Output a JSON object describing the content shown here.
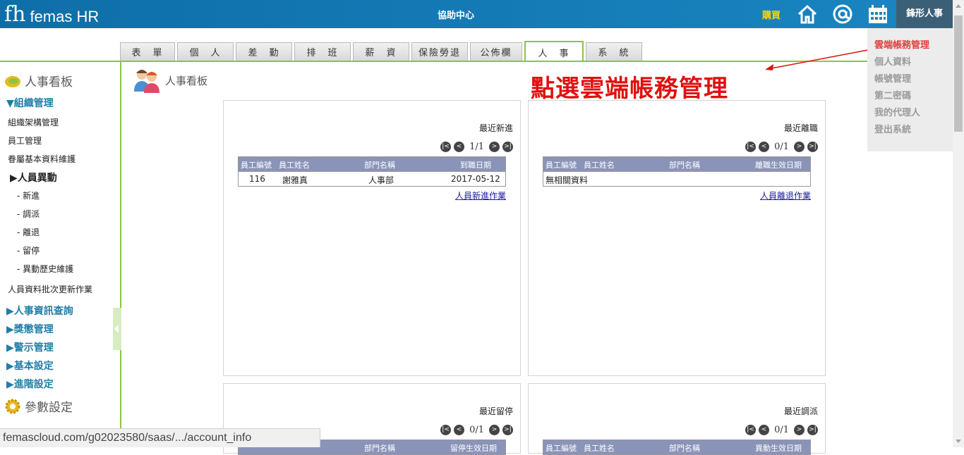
{
  "header": {
    "logo_mark": "fh",
    "logo_text": "femas HR",
    "help_center": "協助中心",
    "buy": "購買",
    "user_menu": "鋒形人事",
    "brand_color": "#1a86c2",
    "buy_color": "#ffd200"
  },
  "tabs": [
    {
      "label": "表　單",
      "active": false
    },
    {
      "label": "個　人",
      "active": false
    },
    {
      "label": "差　勤",
      "active": false
    },
    {
      "label": "排　班",
      "active": false
    },
    {
      "label": "薪　資",
      "active": false
    },
    {
      "label": "保險勞退",
      "active": false
    },
    {
      "label": "公佈欄",
      "active": false
    },
    {
      "label": "人　事",
      "active": true
    },
    {
      "label": "系　統",
      "active": false
    }
  ],
  "sidebar": {
    "board_title": "人事看板",
    "org_section": "▼組織管理",
    "org_items": [
      "組織架構管理",
      "員工管理",
      "眷屬基本資料維護"
    ],
    "change_sub": "▶人員異動",
    "change_items": [
      "- 新進",
      "- 調派",
      "- 離退",
      "- 留停",
      "- 異動歷史維護"
    ],
    "batch_item": "人員資料批次更新作業",
    "sections": [
      "▶人事資訊查詢",
      "▶獎懲管理",
      "▶警示管理",
      "▶基本設定",
      "▶進階設定"
    ],
    "param_title": "參數設定"
  },
  "main": {
    "title": "人事看板"
  },
  "annotation": {
    "text": "點選雲端帳務管理",
    "color": "#e01010"
  },
  "dropdown": {
    "items": [
      {
        "label": "雲端帳務管理",
        "active": true
      },
      {
        "label": "個人資料",
        "active": false
      },
      {
        "label": "帳號管理",
        "active": false
      },
      {
        "label": "第二密碼",
        "active": false
      },
      {
        "label": "我的代理人",
        "active": false
      },
      {
        "label": "登出系統",
        "active": false
      }
    ]
  },
  "panels": {
    "new_hire": {
      "title": "最近新進",
      "page": "1/1",
      "headers": [
        "員工編號",
        "員工姓名",
        "部門名稱",
        "到職日期"
      ],
      "rows": [
        [
          "116",
          "謝雅真",
          "人事部",
          "2017-05-12"
        ]
      ],
      "link": "人員新進作業"
    },
    "resign": {
      "title": "最近離職",
      "page": "0/1",
      "headers": [
        "員工編號",
        "員工姓名",
        "部門名稱",
        "離職生效日期"
      ],
      "empty": "無相關資料",
      "link": "人員離退作業"
    },
    "leave": {
      "title": "最近留停",
      "page": "0/1",
      "headers": [
        "部門名稱",
        "留停生效日期"
      ]
    },
    "transfer": {
      "title": "最近調派",
      "page": "0/1",
      "headers": [
        "員工編號",
        "員工姓名",
        "部門名稱",
        "異動生效日期"
      ]
    }
  },
  "pager_buttons": [
    "|<",
    "<",
    ">",
    ">|"
  ],
  "status_url": "femascloud.com/g02023580/saas/.../account_info"
}
